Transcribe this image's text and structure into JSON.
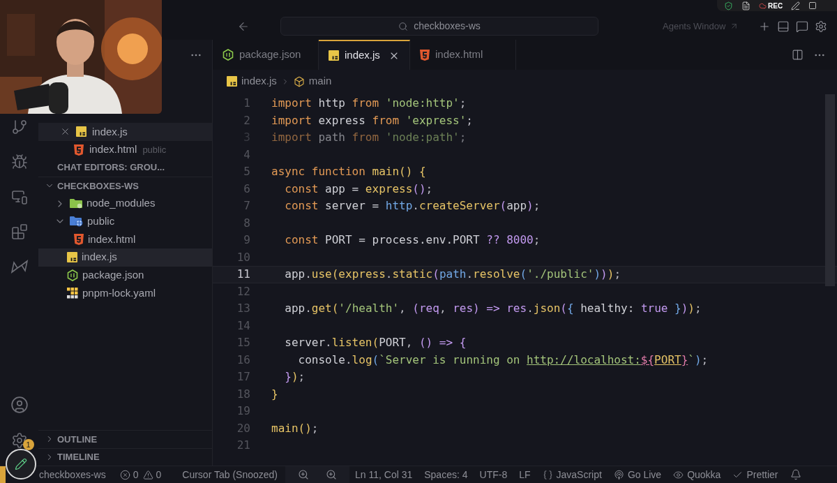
{
  "menu_bar": {
    "recording_label": "REC"
  },
  "title_bar": {
    "search": "checkboxes-ws",
    "agents_window": "Agents Window"
  },
  "sidebar": {
    "open_editors": [
      {
        "name": "index.js",
        "kind": "js",
        "selected": true
      },
      {
        "name": "index.html",
        "kind": "html",
        "folder": "public",
        "selected": false
      }
    ],
    "chat_editors_header": "CHAT EDITORS: GROU...",
    "explorer": {
      "title": "CHECKBOXES-WS",
      "expanded": true,
      "items": [
        {
          "name": "node_modules",
          "kind": "folder",
          "expanded": false,
          "selected": false
        },
        {
          "name": "public",
          "kind": "web-folder",
          "expanded": true,
          "selected": false,
          "children": [
            {
              "name": "index.html",
              "kind": "html",
              "selected": false
            }
          ]
        },
        {
          "name": "index.js",
          "kind": "js",
          "selected": true
        },
        {
          "name": "package.json",
          "kind": "node",
          "selected": false
        },
        {
          "name": "pnpm-lock.yaml",
          "kind": "pnpm",
          "selected": false
        }
      ]
    },
    "panels": [
      {
        "title": "OUTLINE",
        "expanded": false
      },
      {
        "title": "TIMELINE",
        "expanded": false
      }
    ]
  },
  "activity_bar": {
    "settings_badge": "1"
  },
  "tabs": [
    {
      "label": "package.json",
      "kind": "node",
      "selected": false
    },
    {
      "label": "index.js",
      "kind": "js",
      "selected": true
    },
    {
      "label": "index.html",
      "kind": "html",
      "selected": false
    }
  ],
  "breadcrumb": [
    {
      "label": "index.js",
      "kind": "js"
    },
    {
      "label": "main",
      "kind": "symbol"
    }
  ],
  "code": [
    {
      "number": "1",
      "selected": false,
      "dimmed": false,
      "tokens": [
        {
          "kind": "kw",
          "text": "import"
        },
        {
          "kind": "var",
          "text": " http "
        },
        {
          "kind": "kw",
          "text": "from"
        },
        {
          "kind": "str",
          "text": " 'node:http'"
        },
        {
          "kind": "punct",
          "text": ";"
        }
      ]
    },
    {
      "number": "2",
      "selected": false,
      "dimmed": false,
      "tokens": [
        {
          "kind": "kw",
          "text": "import"
        },
        {
          "kind": "var",
          "text": " express "
        },
        {
          "kind": "kw",
          "text": "from"
        },
        {
          "kind": "str",
          "text": " 'express'"
        },
        {
          "kind": "punct",
          "text": ";"
        }
      ]
    },
    {
      "number": "3",
      "selected": false,
      "dimmed": true,
      "tokens": [
        {
          "kind": "kw",
          "text": "import"
        },
        {
          "kind": "var",
          "text": " path "
        },
        {
          "kind": "kw",
          "text": "from"
        },
        {
          "kind": "str",
          "text": " 'node:path'"
        },
        {
          "kind": "punct",
          "text": ";"
        }
      ]
    },
    {
      "number": "4",
      "selected": false,
      "dimmed": false
    },
    {
      "number": "5",
      "selected": false,
      "dimmed": false,
      "tokens": [
        {
          "kind": "kw",
          "text": "async function "
        },
        {
          "kind": "fn",
          "text": "main"
        },
        {
          "kind": "b1",
          "text": "() {"
        }
      ]
    },
    {
      "number": "6",
      "selected": false,
      "dimmed": false,
      "tokens": [
        {
          "kind": "kw",
          "text": "  const "
        },
        {
          "kind": "var",
          "text": "app = "
        },
        {
          "kind": "fn",
          "text": "express"
        },
        {
          "kind": "b2",
          "text": "()"
        },
        {
          "kind": "punct",
          "text": ";"
        }
      ]
    },
    {
      "number": "7",
      "selected": false,
      "dimmed": false,
      "tokens": [
        {
          "kind": "kw",
          "text": "  const "
        },
        {
          "kind": "var",
          "text": "server = "
        },
        {
          "kind": "obj",
          "text": "http"
        },
        {
          "kind": "punct",
          "text": "."
        },
        {
          "kind": "fn",
          "text": "createServer"
        },
        {
          "kind": "b2",
          "text": "("
        },
        {
          "kind": "var",
          "text": "app"
        },
        {
          "kind": "b2",
          "text": ")"
        },
        {
          "kind": "punct",
          "text": ";"
        }
      ]
    },
    {
      "number": "8",
      "selected": false,
      "dimmed": false
    },
    {
      "number": "9",
      "selected": false,
      "dimmed": false,
      "tokens": [
        {
          "kind": "kw",
          "text": "  const "
        },
        {
          "kind": "var",
          "text": "PORT = process.env.PORT "
        },
        {
          "kind": "num",
          "text": "??"
        },
        {
          "kind": "num",
          "text": " 8000"
        },
        {
          "kind": "punct",
          "text": ";"
        }
      ]
    },
    {
      "number": "10",
      "selected": false,
      "dimmed": false
    },
    {
      "number": "11",
      "selected": true,
      "dimmed": false,
      "tokens": [
        {
          "kind": "var",
          "text": "  app"
        },
        {
          "kind": "punct",
          "text": "."
        },
        {
          "kind": "fn",
          "text": "use"
        },
        {
          "kind": "b1",
          "text": "("
        },
        {
          "kind": "fn",
          "text": "express"
        },
        {
          "kind": "punct",
          "text": "."
        },
        {
          "kind": "fn",
          "text": "static"
        },
        {
          "kind": "b2",
          "text": "("
        },
        {
          "kind": "obj",
          "text": "path"
        },
        {
          "kind": "punct",
          "text": "."
        },
        {
          "kind": "fn",
          "text": "resolve"
        },
        {
          "kind": "b3",
          "text": "("
        },
        {
          "kind": "str",
          "text": "'./public'"
        },
        {
          "kind": "b3",
          "text": ")"
        },
        {
          "kind": "b2",
          "text": ")"
        },
        {
          "kind": "b1",
          "text": ")"
        },
        {
          "kind": "punct",
          "text": ";"
        }
      ]
    },
    {
      "number": "12",
      "selected": false,
      "dimmed": false
    },
    {
      "number": "13",
      "selected": false,
      "dimmed": false,
      "tokens": [
        {
          "kind": "var",
          "text": "  app"
        },
        {
          "kind": "punct",
          "text": "."
        },
        {
          "kind": "fn",
          "text": "get"
        },
        {
          "kind": "b1",
          "text": "("
        },
        {
          "kind": "str",
          "text": "'/health'"
        },
        {
          "kind": "punct",
          "text": ", "
        },
        {
          "kind": "b2",
          "text": "("
        },
        {
          "kind": "param",
          "text": "req"
        },
        {
          "kind": "punct",
          "text": ", "
        },
        {
          "kind": "param",
          "text": "res"
        },
        {
          "kind": "b2",
          "text": ")"
        },
        {
          "kind": "num",
          "text": " => "
        },
        {
          "kind": "param",
          "text": "res"
        },
        {
          "kind": "punct",
          "text": "."
        },
        {
          "kind": "fn",
          "text": "json"
        },
        {
          "kind": "b2",
          "text": "("
        },
        {
          "kind": "b3",
          "text": "{"
        },
        {
          "kind": "var",
          "text": " healthy: "
        },
        {
          "kind": "num",
          "text": "true"
        },
        {
          "kind": "b3",
          "text": " }"
        },
        {
          "kind": "b2",
          "text": ")"
        },
        {
          "kind": "b1",
          "text": ")"
        },
        {
          "kind": "punct",
          "text": ";"
        }
      ]
    },
    {
      "number": "14",
      "selected": false,
      "dimmed": false
    },
    {
      "number": "15",
      "selected": false,
      "dimmed": false,
      "tokens": [
        {
          "kind": "var",
          "text": "  server"
        },
        {
          "kind": "punct",
          "text": "."
        },
        {
          "kind": "fn",
          "text": "listen"
        },
        {
          "kind": "b1",
          "text": "("
        },
        {
          "kind": "var",
          "text": "PORT"
        },
        {
          "kind": "punct",
          "text": ", "
        },
        {
          "kind": "b2",
          "text": "()"
        },
        {
          "kind": "num",
          "text": " => "
        },
        {
          "kind": "b2",
          "text": "{"
        }
      ]
    },
    {
      "number": "16",
      "selected": false,
      "dimmed": false,
      "tokens": [
        {
          "kind": "var",
          "text": "    console"
        },
        {
          "kind": "punct",
          "text": "."
        },
        {
          "kind": "fn",
          "text": "log"
        },
        {
          "kind": "b3",
          "text": "("
        },
        {
          "kind": "str",
          "text": "`Server is running on "
        },
        {
          "kind": "link",
          "text": "http://localhost:"
        },
        {
          "kind": "interp",
          "text": "${"
        },
        {
          "kind": "linkvar",
          "text": "PORT"
        },
        {
          "kind": "interp",
          "text": "}"
        },
        {
          "kind": "str",
          "text": "`"
        },
        {
          "kind": "b3",
          "text": ")"
        },
        {
          "kind": "punct",
          "text": ";"
        }
      ]
    },
    {
      "number": "17",
      "selected": false,
      "dimmed": false,
      "tokens": [
        {
          "kind": "b2",
          "text": "  }"
        },
        {
          "kind": "b1",
          "text": ")"
        },
        {
          "kind": "punct",
          "text": ";"
        }
      ]
    },
    {
      "number": "18",
      "selected": false,
      "dimmed": false,
      "tokens": [
        {
          "kind": "b1",
          "text": "}"
        }
      ]
    },
    {
      "number": "19",
      "selected": false,
      "dimmed": false
    },
    {
      "number": "20",
      "selected": false,
      "dimmed": false,
      "tokens": [
        {
          "kind": "fn",
          "text": "main"
        },
        {
          "kind": "b1",
          "text": "()"
        },
        {
          "kind": "punct",
          "text": ";"
        }
      ]
    },
    {
      "number": "21",
      "selected": false,
      "dimmed": false
    }
  ],
  "status_bar": {
    "workspace": "checkboxes-ws",
    "errors": "0",
    "warnings": "0",
    "cursor_tab": "Cursor Tab (Snoozed)",
    "items": [
      {
        "text": "Ln 11, Col 31",
        "kind": "plain"
      },
      {
        "text": "Spaces: 4",
        "kind": "plain"
      },
      {
        "text": "UTF-8",
        "kind": "plain"
      },
      {
        "text": "LF",
        "kind": "plain"
      },
      {
        "text": "JavaScript",
        "kind": "language"
      },
      {
        "text": "Go Live",
        "kind": "broadcast"
      },
      {
        "text": "Quokka",
        "kind": "eye"
      },
      {
        "text": "Prettier",
        "kind": "check"
      }
    ]
  }
}
